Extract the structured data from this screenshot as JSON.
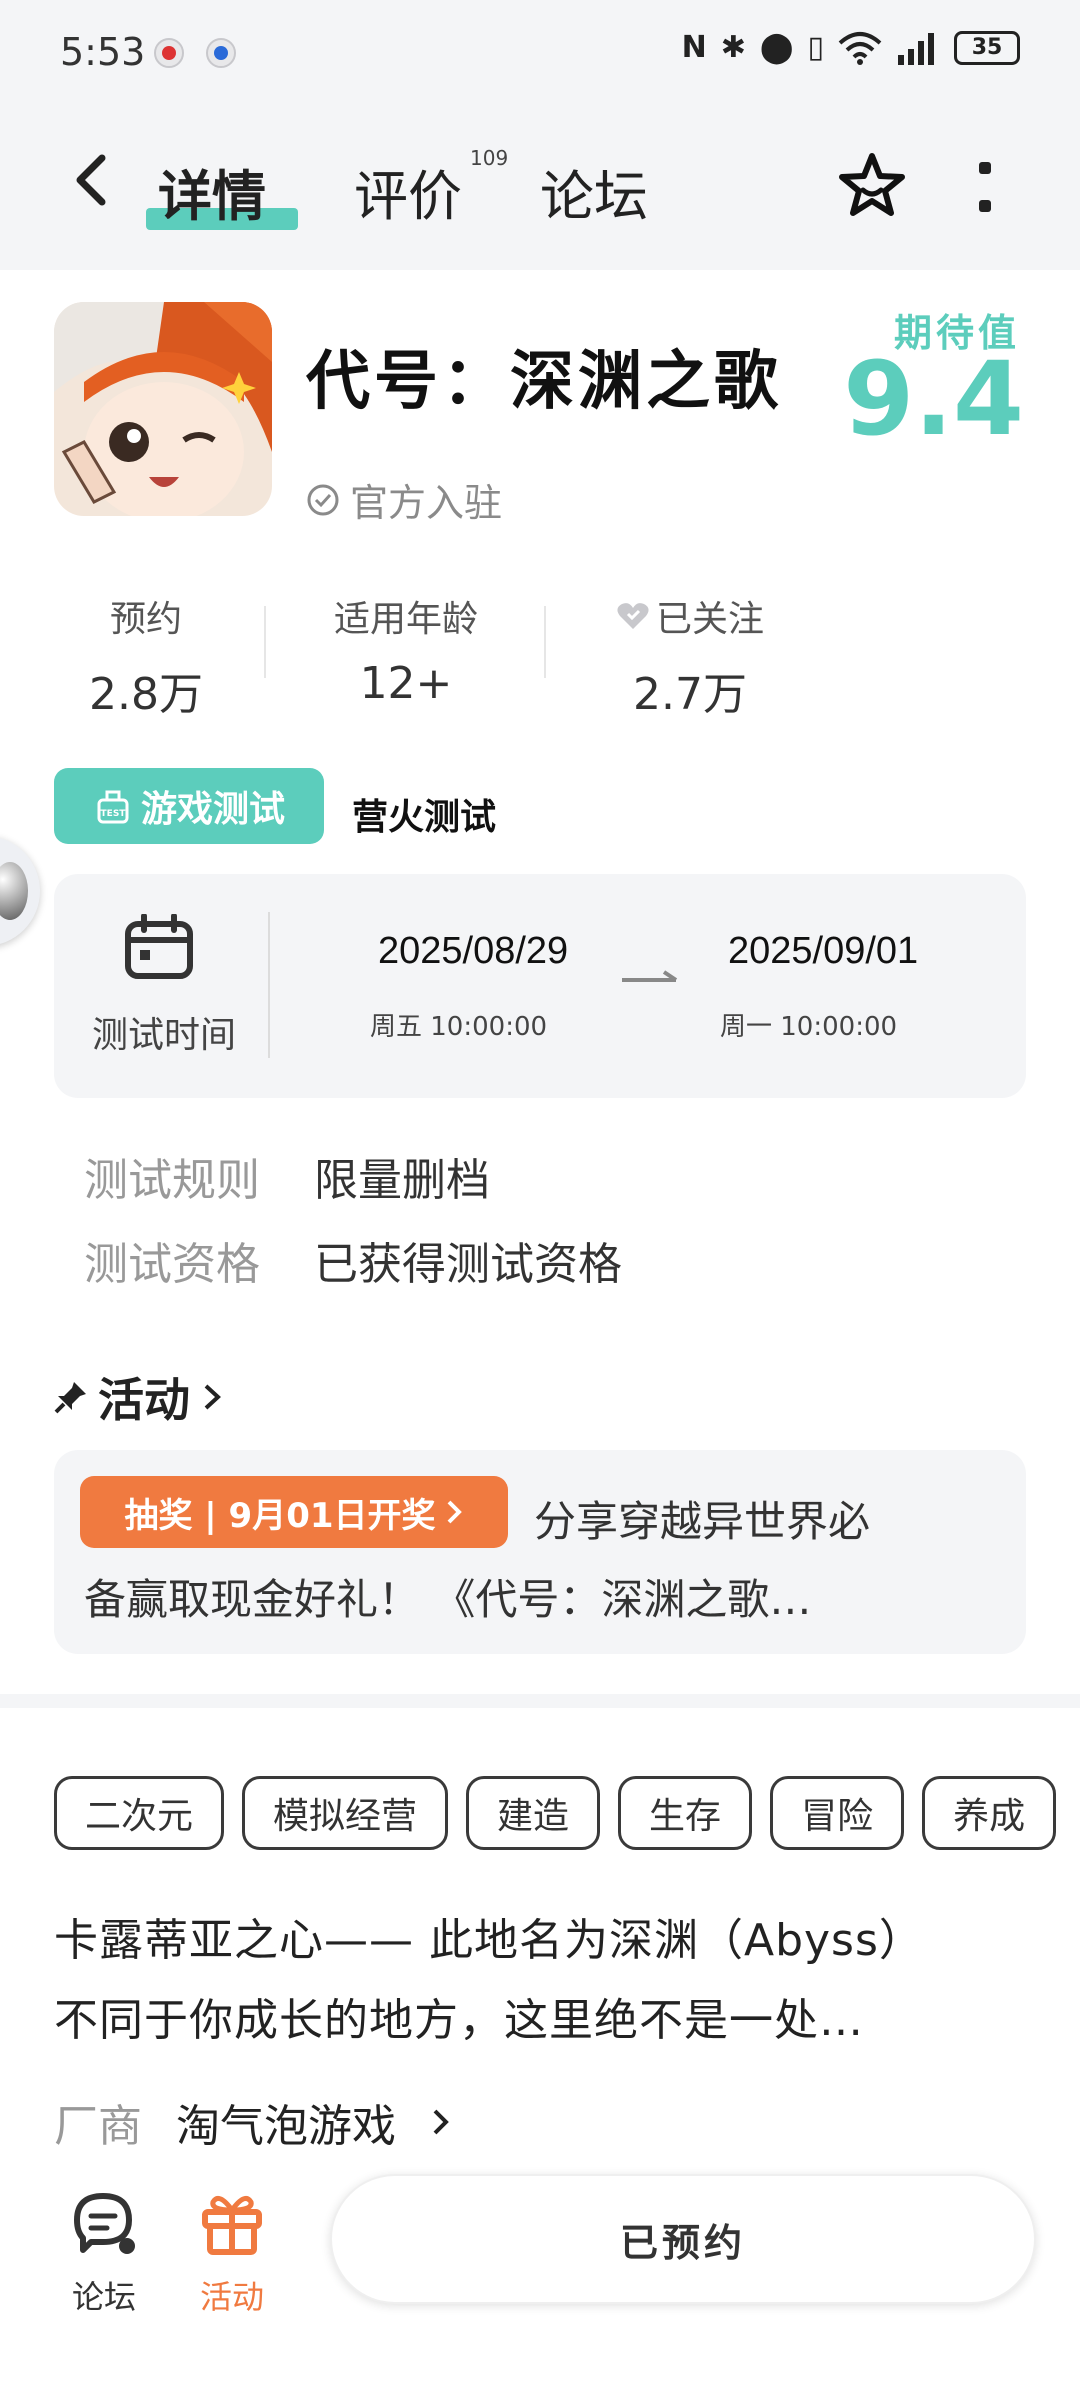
{
  "status_bar": {
    "time": "5:53",
    "battery": "35"
  },
  "nav": {
    "tabs": [
      {
        "label": "详情",
        "active": true
      },
      {
        "label": "评价",
        "badge": "109"
      },
      {
        "label": "论坛"
      }
    ]
  },
  "app": {
    "title": "代号：深渊之歌",
    "official_label": "官方入驻",
    "expect_label": "期待值",
    "expect_value": "9.4"
  },
  "stats": [
    {
      "label": "预约",
      "value": "2.8万"
    },
    {
      "label": "适用年龄",
      "value": "12+"
    },
    {
      "label": "已关注",
      "value": "2.7万"
    }
  ],
  "test": {
    "tag": "游戏测试",
    "name": "营火测试",
    "time_label": "测试时间",
    "start_date": "2025/08/29",
    "start_weekday": "周五  10:00:00",
    "end_date": "2025/09/01",
    "end_weekday": "周一  10:00:00",
    "rules": [
      {
        "key": "测试规则",
        "value": "限量删档"
      },
      {
        "key": "测试资格",
        "value": "已获得测试资格"
      }
    ]
  },
  "activity": {
    "heading": "活动",
    "tag": "抽奖 | 9月01日开奖",
    "line1": "分享穿越异世界必",
    "line2": "备赢取现金好礼！ 《代号：深渊之歌…"
  },
  "chips": [
    "二次元",
    "模拟经营",
    "建造",
    "生存",
    "冒险",
    "养成"
  ],
  "description": {
    "line1": "卡露蒂亚之心—— 此地名为深渊（Abyss）",
    "line2": "不同于你成长的地方，这里绝不是一处…"
  },
  "vendor": {
    "key": "厂商",
    "value": "淘气泡游戏"
  },
  "bottom": {
    "forum_label": "论坛",
    "activity_label": "活动",
    "reserved_label": "已预约"
  },
  "colors": {
    "accent": "#5ccdbc",
    "orange": "#f07a40"
  }
}
